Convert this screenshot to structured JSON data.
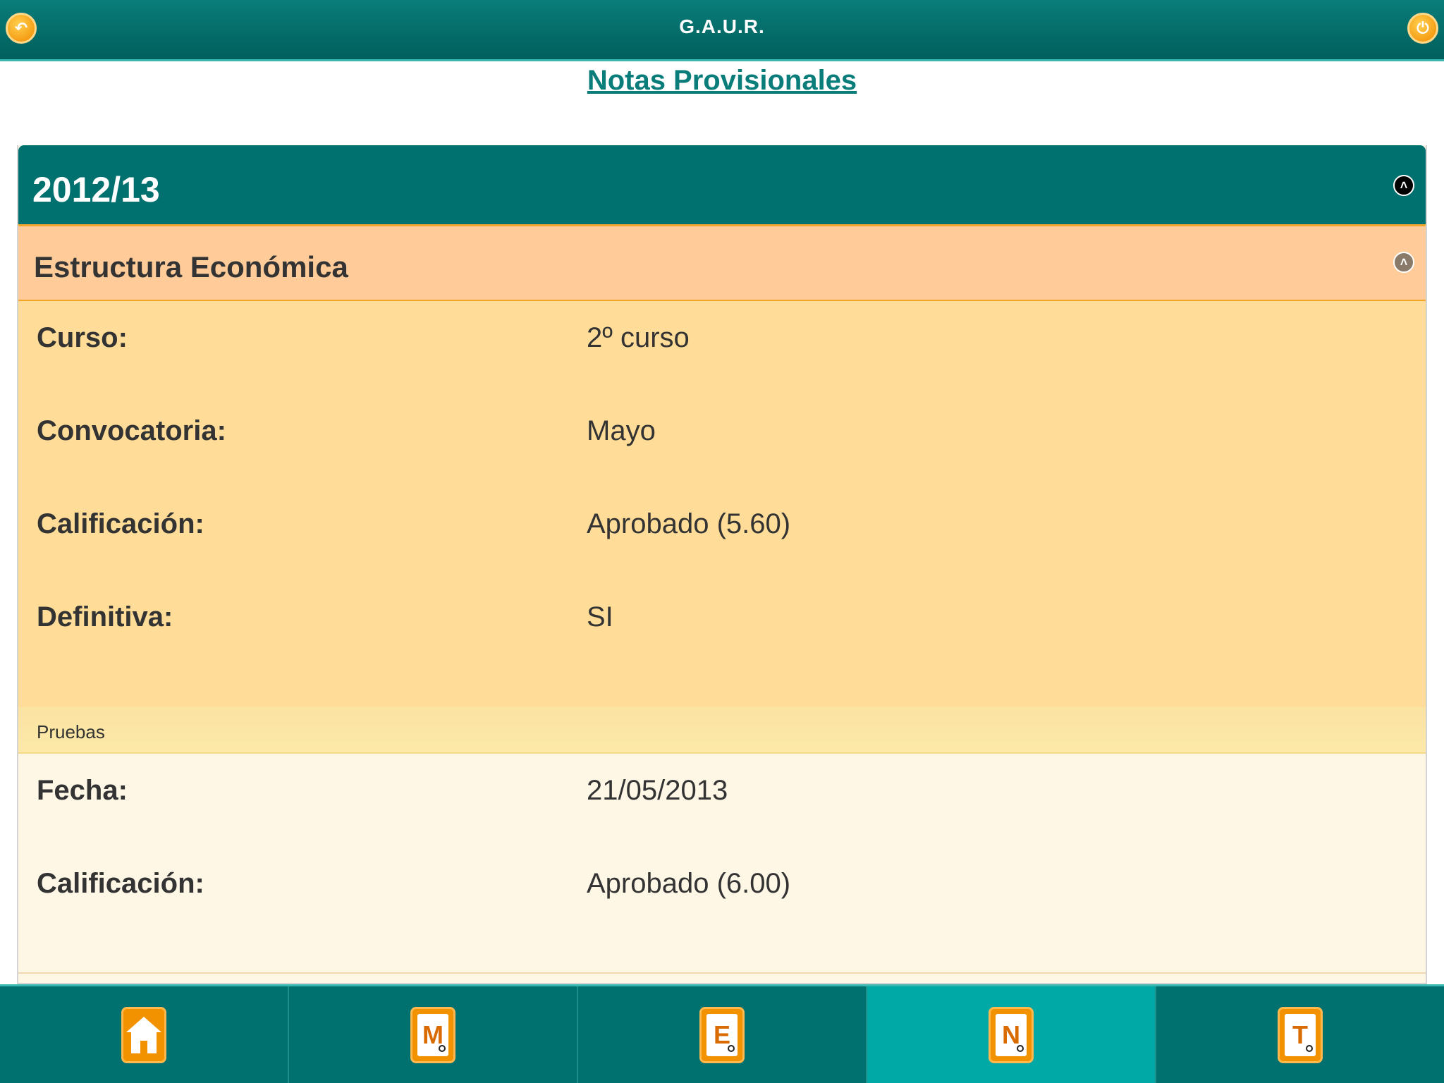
{
  "header": {
    "title": "G.A.U.R.",
    "back_icon": "back-arrow-icon",
    "power_icon": "power-icon"
  },
  "page_title": "Notas Provisionales",
  "year": {
    "label": "2012/13",
    "toggle_icon": "chevron-up-icon"
  },
  "subject": {
    "name": "Estructura Económica",
    "toggle_icon": "chevron-up-icon",
    "fields": [
      {
        "label": "Curso:",
        "value": "2º curso"
      },
      {
        "label": "Convocatoria:",
        "value": "Mayo"
      },
      {
        "label": "Calificación:",
        "value": "Aprobado (5.60)"
      },
      {
        "label": "Definitiva:",
        "value": "SI"
      }
    ]
  },
  "pruebas": {
    "section_label": "Pruebas",
    "fields": [
      {
        "label": "Fecha:",
        "value": "21/05/2013"
      },
      {
        "label": "Calificación:",
        "value": "Aprobado (6.00)"
      }
    ]
  },
  "bottom_nav": [
    {
      "icon": "home-icon",
      "letter": "",
      "active": false
    },
    {
      "icon": "matricula-search-icon",
      "letter": "M",
      "active": false
    },
    {
      "icon": "expediente-search-icon",
      "letter": "E",
      "active": false
    },
    {
      "icon": "notas-search-icon",
      "letter": "N",
      "active": true
    },
    {
      "icon": "tramites-search-icon",
      "letter": "T",
      "active": false
    }
  ],
  "colors": {
    "header_teal": "#00716e",
    "accent_orange": "#f39200",
    "subject_bar": "#ffcb99",
    "details_bg": "#ffdd99",
    "tests_bg": "#fff7e6",
    "active_nav": "#00a8a6"
  }
}
